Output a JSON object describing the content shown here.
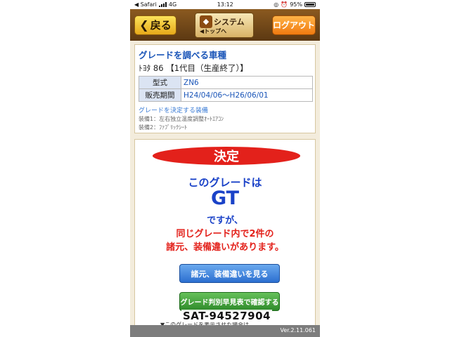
{
  "status_bar": {
    "carrier": "◀ Safari",
    "network": "4G",
    "time": "13:12",
    "battery": "95%"
  },
  "toolbar": {
    "back_label": "戻る",
    "logo_text": "システム",
    "logo_top_label": "◀トップへ",
    "logout_label": "ログアウト"
  },
  "vehicle": {
    "heading": "グレードを調べる車種",
    "name": "ﾄﾖﾀ  86 【1代目（生産終了）】",
    "spec": [
      {
        "label": "型式",
        "value": "ZN6"
      },
      {
        "label": "販売期間",
        "value": "H24/04/06〜H26/06/01"
      }
    ],
    "equipment_heading": "グレードを決定する装備",
    "equipment": [
      "装備1：左右独立温度調整ｵｰﾄｴｱｺﾝ",
      "装備2：ﾌｧﾌﾞﾘｯｸｼｰﾄ"
    ]
  },
  "result": {
    "badge": "決定",
    "line1": "このグレードは",
    "grade": "GT",
    "line2": "ですが、",
    "line3": "同じグレード内で2件の",
    "line4": "諸元、装備違いがあります。",
    "compare_button": "諸元、装備違いを見る",
    "check_button": "グレード判別早見表で確認する",
    "note": "▼このグレードを表示させた場合は"
  },
  "watermark": "SAT-94527904",
  "version": "Ver.2.11.061",
  "colors": {
    "brand_brown": "#6e4416",
    "accent_red": "#e3211b",
    "accent_blue": "#1a42c8"
  }
}
